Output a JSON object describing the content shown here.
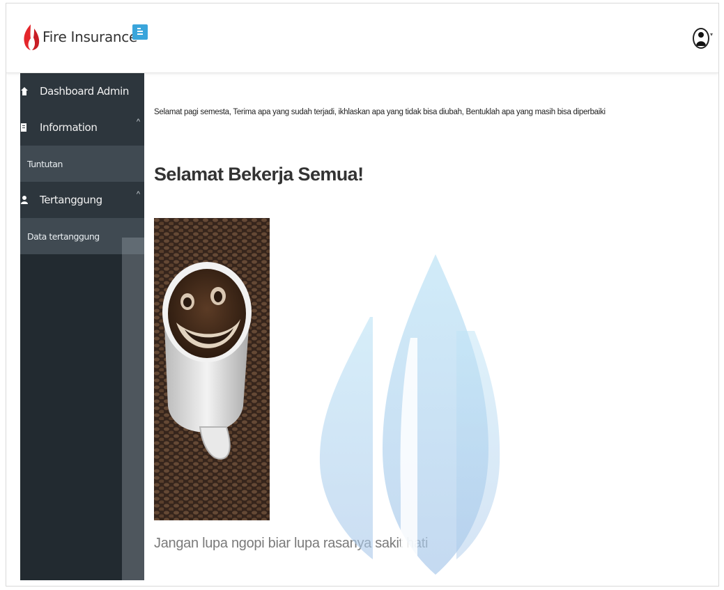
{
  "header": {
    "brand": "Fire Insurance",
    "icons": {
      "logo": "flame-icon",
      "toggle": "menu-toggle-icon",
      "user": "user-avatar-icon",
      "caret": "chevron-down-icon"
    }
  },
  "sidebar": {
    "items": [
      {
        "label": "Dashboard Admin",
        "icon": "home-icon"
      },
      {
        "label": "Information",
        "icon": "document-icon",
        "expanded": true,
        "children": [
          {
            "label": "Tuntutan"
          }
        ]
      },
      {
        "label": "Tertanggung",
        "icon": "user-icon",
        "expanded": true,
        "children": [
          {
            "label": "Data tertanggung"
          }
        ]
      }
    ]
  },
  "main": {
    "greeting": "Selamat pagi semesta, Terima apa yang sudah terjadi, ikhlaskan apa yang tidak bisa diubah, Bentuklah apa yang masih bisa diperbaiki",
    "heading": "Selamat Bekerja Semua!",
    "image_icon": "smiling-coffee-cup-image",
    "caption": "Jangan lupa ngopi biar lupa rasanya sakit hati"
  },
  "colors": {
    "sidebar_bg": "#222a30",
    "sidebar_item": "#2d363d",
    "sidebar_subitem": "#404a52",
    "accent": "#3aa5db",
    "flame_red": "#e4262b",
    "watermark_blue": "#a9d6ee"
  }
}
